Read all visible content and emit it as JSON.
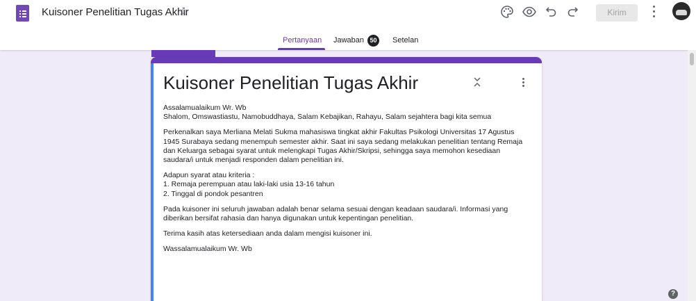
{
  "app": {
    "title": "Kuisoner Penelitian Tugas Akhir",
    "accent_color": "#673ab7",
    "send_button_label": "Kirim"
  },
  "icons": {
    "star": "star-outline-icon",
    "palette": "palette-icon",
    "preview": "eye-icon",
    "undo": "undo-icon",
    "redo": "redo-icon",
    "more": "more-vert-icon",
    "help": "help-icon"
  },
  "tabs": {
    "questions": "Pertanyaan",
    "responses": "Jawaban",
    "responses_count": "50",
    "settings": "Setelan"
  },
  "form": {
    "title": "Kuisoner Penelitian Tugas Akhir",
    "paragraphs": [
      "Assalamualaikum Wr. Wb\nShalom, Omswastiastu, Namobuddhaya, Salam Kebajikan, Rahayu, Salam sejahtera bagi kita semua",
      "Perkenalkan saya Merliana Melati Sukma mahasiswa tingkat akhir Fakultas Psikologi Universitas 17 Agustus 1945 Surabaya sedang menempuh semester akhir. Saat ini saya sedang melakukan penelitian tentang Remaja dan Keluarga  sebagai syarat untuk melengkapi Tugas Akhir/Skripsi, sehingga saya memohon kesediaan saudara/i untuk menjadi responden dalam penelitian ini.",
      "Adapun syarat atau kriteria :\n1. Remaja perempuan atau laki-laki usia 13-16 tahun\n2. Tinggal di pondok pesantren",
      "Pada kuisoner ini seluruh jawaban adalah benar selama sesuai dengan keadaan saudara/i. Informasi yang diberikan bersifat rahasia dan hanya digunakan untuk kepentingan penelitian.",
      "Terima kasih atas ketersediaan anda dalam mengisi kuisoner ini.",
      "Wassalamualaikum Wr. Wb"
    ]
  }
}
